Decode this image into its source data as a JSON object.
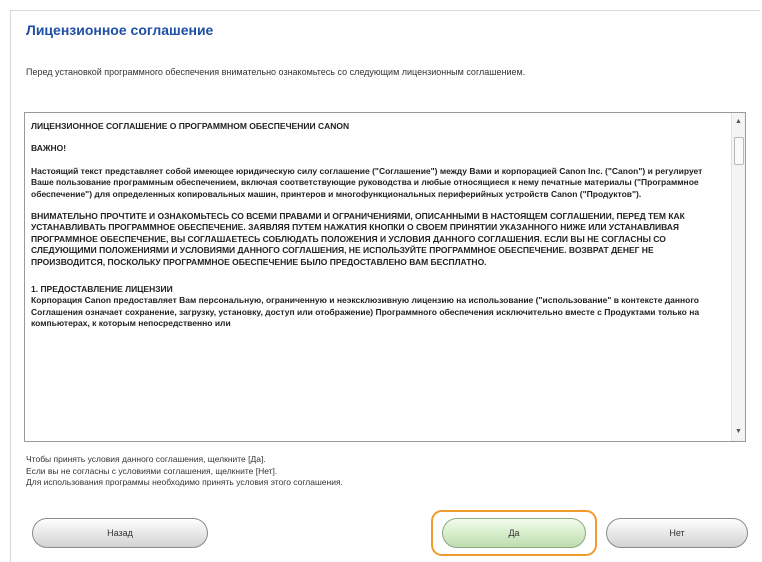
{
  "dialog": {
    "title": "Лицензионное соглашение",
    "intro": "Перед установкой программного обеспечения внимательно ознакомьтесь со следующим лицензионным соглашением."
  },
  "license": {
    "heading": "ЛИЦЕНЗИОННОЕ СОГЛАШЕНИЕ О ПРОГРАММНОМ ОБЕСПЕЧЕНИИ CANON",
    "important": "ВАЖНО!",
    "paragraph1": "Настоящий текст представляет собой имеющее юридическую силу соглашение (\"Соглашение\") между Вами и корпорацией Canon Inc. (\"Canon\") и регулирует Ваше пользование программным обеспечением, включая соответствующие руководства и любые относящиеся к нему печатные материалы (\"Программное обеспечение\") для определенных копировальных машин, принтеров и многофункциональных периферийных устройств Canon (\"Продуктов\").",
    "paragraph2": "ВНИМАТЕЛЬНО ПРОЧТИТЕ И ОЗНАКОМЬТЕСЬ СО ВСЕМИ ПРАВАМИ И ОГРАНИЧЕНИЯМИ, ОПИСАННЫМИ В НАСТОЯЩЕМ СОГЛАШЕНИИ, ПЕРЕД ТЕМ КАК УСТАНАВЛИВАТЬ ПРОГРАММНОЕ ОБЕСПЕЧЕНИЕ. ЗАЯВЛЯЯ ПУТЕМ НАЖАТИЯ КНОПКИ О СВОЕМ ПРИНЯТИИ УКАЗАННОГО НИЖЕ ИЛИ УСТАНАВЛИВАЯ ПРОГРАММНОЕ ОБЕСПЕЧЕНИЕ, ВЫ СОГЛАШАЕТЕСЬ СОБЛЮДАТЬ ПОЛОЖЕНИЯ И УСЛОВИЯ ДАННОГО СОГЛАШЕНИЯ. ЕСЛИ ВЫ НЕ СОГЛАСНЫ СО СЛЕДУЮЩИМИ ПОЛОЖЕНИЯМИ И УСЛОВИЯМИ ДАННОГО СОГЛАШЕНИЯ, НЕ ИСПОЛЬЗУЙТЕ ПРОГРАММНОЕ ОБЕСПЕЧЕНИЕ. ВОЗВРАТ ДЕНЕГ НЕ ПРОИЗВОДИТСЯ, ПОСКОЛЬКУ ПРОГРАММНОЕ ОБЕСПЕЧЕНИЕ БЫЛО ПРЕДОСТАВЛЕНО ВАМ БЕСПЛАТНО.",
    "section1_heading": "1. ПРЕДОСТАВЛЕНИЕ ЛИЦЕНЗИИ",
    "section1_text": "Корпорация Canon предоставляет Вам персональную, ограниченную и неэксклюзивную лицензию на использование (\"использование\" в контексте данного Соглашения означает сохранение, загрузку, установку, доступ или отображение) Программного обеспечения исключительно вместе с Продуктами только на компьютерах, к которым непосредственно или"
  },
  "instructions": {
    "line1": "Чтобы принять условия данного соглашения, щелкните [Да].",
    "line2": "Если вы не согласны с условиями соглашения, щелкните [Нет].",
    "line3": "Для использования программы необходимо принять условия этого соглашения."
  },
  "buttons": {
    "back": "Назад",
    "yes": "Да",
    "no": "Нет"
  },
  "colors": {
    "title": "#1f4fa3",
    "focus_ring": "#f39a2e",
    "yes_button": "#d4ecc8"
  },
  "icons": {
    "scroll_up": "▲",
    "scroll_down": "▼"
  }
}
